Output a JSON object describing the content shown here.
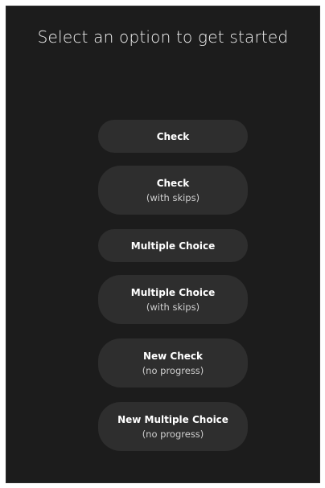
{
  "header": {
    "title": "Select an option to get started"
  },
  "options": [
    {
      "label": "Check",
      "sublabel": ""
    },
    {
      "label": "Check",
      "sublabel": "(with skips)"
    },
    {
      "label": "Multiple Choice",
      "sublabel": ""
    },
    {
      "label": "Multiple Choice",
      "sublabel": "(with skips)"
    },
    {
      "label": "New Check",
      "sublabel": "(no progress)"
    },
    {
      "label": "New Multiple Choice",
      "sublabel": "(no progress)"
    }
  ],
  "colors": {
    "background": "#1c1c1c",
    "button": "#2e2e2e",
    "text": "#ffffff",
    "subtext": "#cfcfcf"
  }
}
